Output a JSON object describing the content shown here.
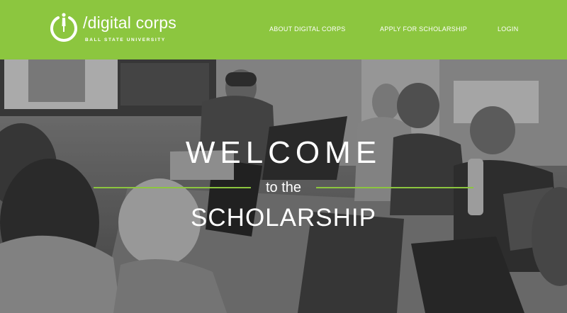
{
  "brand": {
    "name": "/digital corps",
    "subtitle": "BALL STATE UNIVERSITY",
    "accent_color": "#8cc63f"
  },
  "nav": {
    "about": "ABOUT DIGITAL CORPS",
    "apply": "APPLY FOR SCHOLARSHIP",
    "login": "LOGIN"
  },
  "hero": {
    "line1": "WELCOME",
    "line2": "to the",
    "line3": "SCHOLARSHIP"
  }
}
